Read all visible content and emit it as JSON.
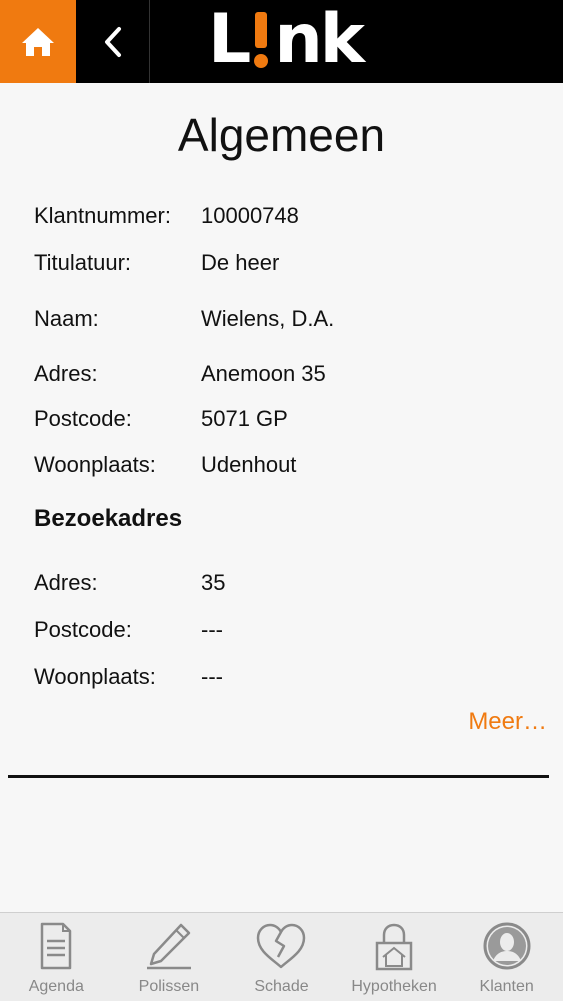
{
  "header": {
    "home_icon": "home-icon",
    "back_icon": "chevron-left-icon",
    "logo": {
      "left": "L",
      "right": "nk"
    },
    "accent_color": "#f07a10"
  },
  "page": {
    "title": "Algemeen"
  },
  "general": [
    {
      "label": "Klantnummer:",
      "value": "10000748"
    },
    {
      "label": "Titulatuur:",
      "value": "De heer"
    },
    {
      "label": "Naam:",
      "value": "Wielens, D.A."
    },
    {
      "label": "Adres:",
      "value": "Anemoon 35"
    },
    {
      "label": "Postcode:",
      "value": "5071 GP"
    },
    {
      "label": "Woonplaats:",
      "value": "Udenhout"
    }
  ],
  "visit": {
    "heading": "Bezoekadres",
    "rows": [
      {
        "label": "Adres:",
        "value": "35"
      },
      {
        "label": "Postcode:",
        "value": "---"
      },
      {
        "label": "Woonplaats:",
        "value": "---"
      }
    ]
  },
  "more_link": "Meer…",
  "tabbar": {
    "tabs": [
      {
        "label": "Agenda",
        "icon": "document-icon"
      },
      {
        "label": "Polissen",
        "icon": "pencil-icon"
      },
      {
        "label": "Schade",
        "icon": "broken-heart-icon"
      },
      {
        "label": "Hypotheken",
        "icon": "house-lock-icon"
      },
      {
        "label": "Klanten",
        "icon": "person-icon"
      }
    ]
  }
}
